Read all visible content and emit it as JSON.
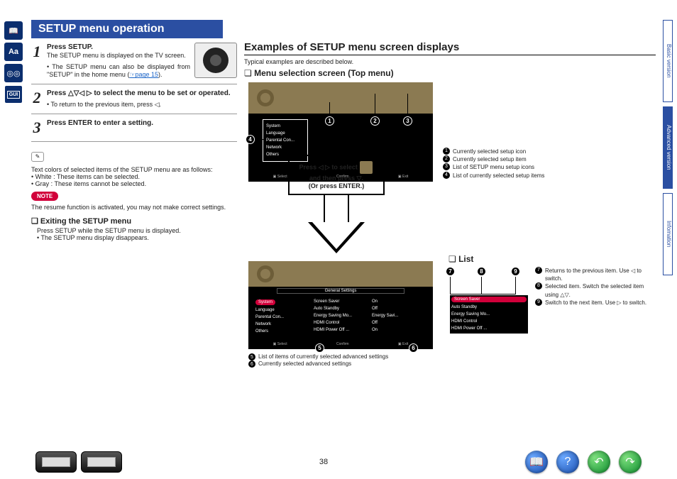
{
  "title": "SETUP menu operation",
  "steps": {
    "s1": {
      "num": "1",
      "head": "Press SETUP.",
      "body": "The SETUP menu is displayed on the TV screen.",
      "bullet": "The SETUP menu can also be displayed from \"SETUP\" in the home menu (",
      "link": "☞page 15",
      "bullet_end": ")."
    },
    "s2": {
      "num": "2",
      "head": "Press △▽◁ ▷ to select the menu to be set or operated.",
      "bullet": "To return to the previous item, press ◁."
    },
    "s3": {
      "num": "3",
      "head": "Press ENTER to enter a setting."
    }
  },
  "colors_note": {
    "intro": "Text colors of selected items of the SETUP menu are as follows:",
    "b1": "• White : These items can be selected.",
    "b2": "• Gray : These items cannot be selected."
  },
  "note_badge": "NOTE",
  "resume": "The resume function is activated, you may not make correct settings.",
  "exiting": {
    "title": "Exiting the SETUP menu",
    "l1": "Press SETUP while the SETUP menu is displayed.",
    "l2": "• The SETUP menu display disappears."
  },
  "right": {
    "h2": "Examples of SETUP menu screen displays",
    "sub": "Typical examples are described below.",
    "menu_sel": "Menu selection screen (Top menu)",
    "list": "List"
  },
  "screen1": {
    "items": [
      "System",
      "Language",
      "Parental Con...",
      "Network",
      "Others"
    ],
    "foot": [
      "Select",
      "Confirm",
      "Exit"
    ]
  },
  "arrow_box": {
    "l1": "Press ◁ ▷ to select",
    "l2": "and then press ▽.",
    "l3": "(Or press ENTER.)"
  },
  "legend1": {
    "i1": "Currently selected setup icon",
    "i2": "Currently selected setup item",
    "i3": "List of SETUP menu setup icons",
    "i4": "List of currently selected setup items"
  },
  "screen2": {
    "gs": "General Settings",
    "c1": [
      "System",
      "Language",
      "Parental Con...",
      "Network",
      "Others"
    ],
    "c2": [
      "Screen Saver",
      "Auto Standby",
      "Energy Saving Mo...",
      "HDMI Control",
      "HDMI Power Off ..."
    ],
    "c3": [
      "On",
      "Off",
      "Energy Savi...",
      "Off",
      "On"
    ],
    "foot": [
      "Select",
      "Confirm",
      "Exit"
    ]
  },
  "legend2": {
    "i5": "List of items of currently selected advanced settings",
    "i6": "Currently selected advanced settings"
  },
  "listbox": {
    "items": [
      "Screen Saver",
      "Auto Standby",
      "Energy Saving Mo...",
      "HDMI Control",
      "HDMI Power Off ..."
    ]
  },
  "legend3": {
    "i7": "Returns to the previous item. Use ◁ to switch.",
    "i8": "Selected item. Switch the selected item using △▽.",
    "i9": "Switch to the next item. Use ▷ to switch."
  },
  "tabs": {
    "basic": "Basic version",
    "adv": "Advanced version",
    "info": "Infomation"
  },
  "pagenum": "38",
  "markers": {
    "m1": "1",
    "m2": "2",
    "m3": "3",
    "m4": "4",
    "m5": "5",
    "m6": "6",
    "m7": "7",
    "m8": "8",
    "m9": "9"
  }
}
